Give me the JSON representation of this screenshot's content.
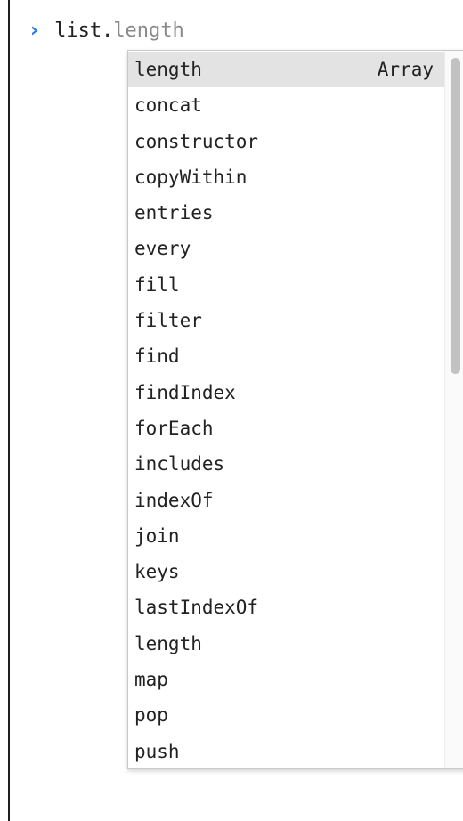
{
  "console": {
    "prompt_icon": "chevron-right-icon",
    "typed_text": "list.",
    "suggestion_text": "length"
  },
  "autocomplete": {
    "selected_index": 0,
    "selected_type": "Array",
    "items": [
      "length",
      "concat",
      "constructor",
      "copyWithin",
      "entries",
      "every",
      "fill",
      "filter",
      "find",
      "findIndex",
      "forEach",
      "includes",
      "indexOf",
      "join",
      "keys",
      "lastIndexOf",
      "length",
      "map",
      "pop",
      "push"
    ]
  },
  "colors": {
    "prompt": "#2a7de1",
    "selected_row": "#e3e3e3",
    "suggestion": "#8a8a8a"
  }
}
